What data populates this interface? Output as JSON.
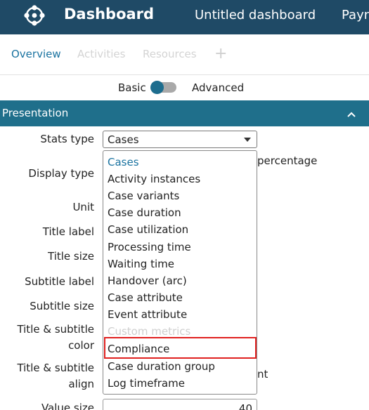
{
  "header": {
    "app_title": "Dashboard",
    "dashboard_name": "Untitled dashboard",
    "next_truncated": "Payn",
    "bg_color": "#1f4a66",
    "logo_icon": "logo-icon"
  },
  "tabs": [
    {
      "label": "Overview",
      "active": true
    },
    {
      "label": "Activities",
      "active": false
    },
    {
      "label": "Resources",
      "active": false
    }
  ],
  "add_tab_icon": "+",
  "mode": {
    "basic_label": "Basic",
    "advanced_label": "Advanced",
    "selected": "Basic"
  },
  "section": {
    "title": "Presentation",
    "caret": "^",
    "bg_color": "#1f6f8b"
  },
  "form_labels": {
    "stats_type": "Stats type",
    "display_type": "Display type",
    "unit": "Unit",
    "title_label": "Title label",
    "title_size": "Title size",
    "subtitle_label": "Subtitle label",
    "subtitle_size": "Subtitle size",
    "title_subtitle_color": "Title & subtitle\ncolor",
    "title_subtitle_align": "Title & subtitle\nalign",
    "value_size": "Value size"
  },
  "stats_type_select": {
    "value": "Cases"
  },
  "behind_dropdown": {
    "percentage": "percentage",
    "nt": "nt"
  },
  "value_size": "40",
  "dropdown": {
    "options": [
      {
        "label": "Cases",
        "state": "selected"
      },
      {
        "label": "Activity instances",
        "state": "normal"
      },
      {
        "label": "Case variants",
        "state": "normal"
      },
      {
        "label": "Case duration",
        "state": "normal"
      },
      {
        "label": "Case utilization",
        "state": "normal"
      },
      {
        "label": "Processing time",
        "state": "normal"
      },
      {
        "label": "Waiting time",
        "state": "normal"
      },
      {
        "label": "Handover (arc)",
        "state": "normal"
      },
      {
        "label": "Case attribute",
        "state": "normal"
      },
      {
        "label": "Event attribute",
        "state": "normal"
      },
      {
        "label": "Custom metrics",
        "state": "disabled"
      },
      {
        "label": "Compliance",
        "state": "highlighted"
      },
      {
        "label": "Case duration group",
        "state": "normal"
      },
      {
        "label": "Log timeframe",
        "state": "normal"
      }
    ],
    "highlight_color": "#e0201f",
    "accent_color": "#1a73a0"
  }
}
